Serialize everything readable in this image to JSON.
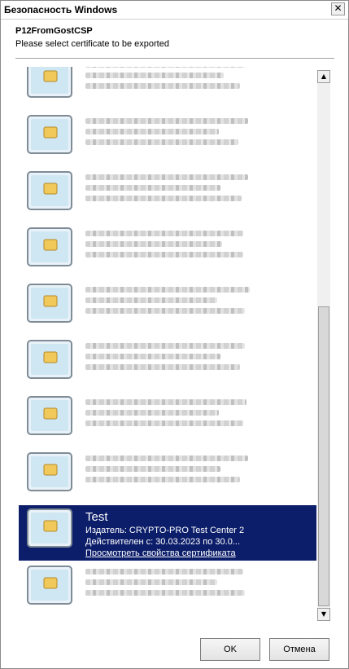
{
  "window": {
    "title": "Безопасность Windows",
    "close_label": "✕"
  },
  "dialog": {
    "header_title": "P12FromGostCSP",
    "header_subtitle": "Please select certificate to be exported"
  },
  "certificates": {
    "selected": {
      "name": "Test",
      "issuer": "Издатель: CRYPTO-PRO Test Center 2",
      "validity": "Действителен с: 30.03.2023 по 30.0...",
      "properties_link": "Просмотреть свойства сертификата"
    }
  },
  "scrollbar": {
    "up_arrow": "▲",
    "down_arrow": "▼"
  },
  "buttons": {
    "ok": "OK",
    "cancel": "Отмена"
  },
  "colors": {
    "selection": "#0c1e6a"
  }
}
